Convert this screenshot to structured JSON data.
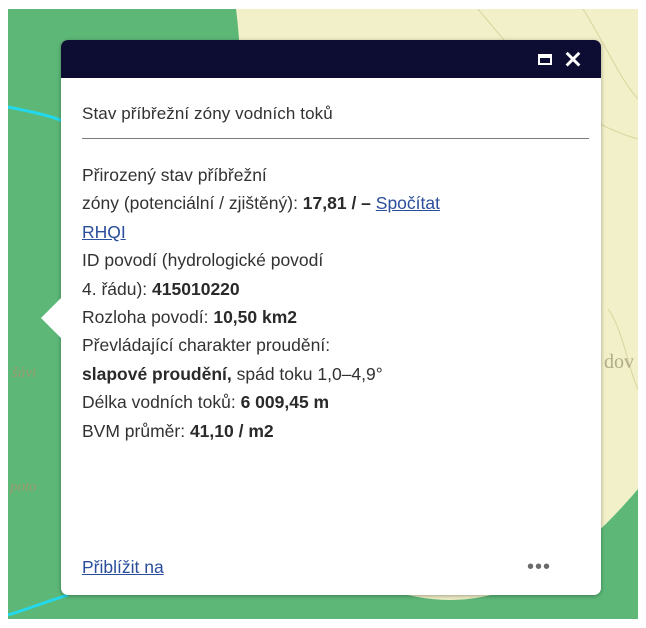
{
  "map": {
    "labels": [
      "šávi",
      "poto",
      "dov"
    ]
  },
  "popup": {
    "title": "Stav příbřežní zóny vodních toků",
    "fields": {
      "natural_state_line1": "Přirozený stav příbřežní",
      "natural_state_label": "zóny (potenciální / zjištěný): ",
      "natural_state_value": "17,81 / – ",
      "compute_link_part1": "Spočítat",
      "compute_link_part2": "RHQI",
      "basin_id_line1": "ID povodí (hydrologické povodí",
      "basin_id_label": "4. řádu): ",
      "basin_id_value": "415010220",
      "area_label": "Rozloha povodí: ",
      "area_value": "10,50 km2",
      "flow_label": "Převládající charakter proudění:",
      "flow_value": "slapové proudění,",
      "flow_rest": " spád toku 1,0–4,9°",
      "length_label": "Délka vodních toků: ",
      "length_value": "6 009,45 m",
      "bvm_label": "BVM průměr: ",
      "bvm_value": "41,10 / m2"
    },
    "footer": {
      "zoom_link": "Přiblížit na",
      "more_label": "•••"
    }
  },
  "colors": {
    "header": "#0d0d33",
    "link": "#2a4e9b",
    "map_green": "#5db878",
    "map_background": "#f2f0c8",
    "river": "#23d8ec"
  }
}
